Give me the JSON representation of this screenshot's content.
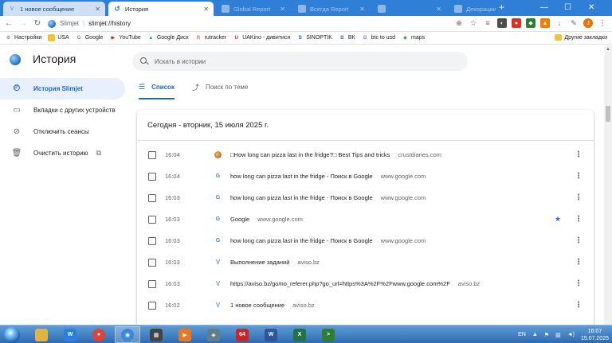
{
  "tabs": [
    {
      "title": "1 новое сообщение",
      "state": "inactive"
    },
    {
      "title": "История",
      "state": "active"
    },
    {
      "title": "Global Report",
      "state": "faded"
    },
    {
      "title": "Всегда Report",
      "state": "faded"
    },
    {
      "title": "",
      "state": "faded"
    },
    {
      "title": "Декорации – акция",
      "state": "faded"
    }
  ],
  "toolbar": {
    "site_label": "Slimjet",
    "url": "slimjet://history"
  },
  "bookmarks": [
    {
      "label": "Настройки",
      "color": "#5f6368",
      "glyph": "⚙"
    },
    {
      "label": "USA",
      "color": "#f4c430",
      "glyph": ""
    },
    {
      "label": "Google",
      "color": "#4285f4",
      "glyph": "G"
    },
    {
      "label": "YouTube",
      "color": "#ff0000",
      "glyph": "▶"
    },
    {
      "label": "Google Диск",
      "color": "#0f9d58",
      "glyph": "▲"
    },
    {
      "label": "rutracker",
      "color": "#e8702a",
      "glyph": "R"
    },
    {
      "label": "UAKino - дивитися",
      "color": "#c4161c",
      "glyph": "U"
    },
    {
      "label": "SINOPTIK",
      "color": "#1f5aa6",
      "glyph": "S"
    },
    {
      "label": "ВК",
      "color": "#4c75a3",
      "glyph": "В"
    },
    {
      "label": "btc to usd",
      "color": "#4285f4",
      "glyph": "G"
    },
    {
      "label": "maps",
      "color": "#34a853",
      "glyph": "◆"
    }
  ],
  "bookmarks_other": "Другие закладки",
  "page": {
    "title": "История",
    "search_placeholder": "Искать в истории"
  },
  "sidebar": [
    {
      "label": "История Slimjet",
      "icon": "history-icon",
      "selected": true
    },
    {
      "label": "Вкладки с других устройств",
      "icon": "devices-icon",
      "selected": false
    },
    {
      "label": "Отключить сеансы",
      "icon": "link-off-icon",
      "selected": false
    },
    {
      "label": "Очистить историю",
      "icon": "trash-icon",
      "selected": false
    }
  ],
  "history_tabs": [
    {
      "label": "Список",
      "selected": true
    },
    {
      "label": "Поиск по теме",
      "selected": false
    }
  ],
  "date_header": "Сегодня - вторник, 15 июля 2025 г.",
  "rows": [
    {
      "time": "16:04",
      "title": "□How long can pizza last in the fridge?□ Best Tips and tricks",
      "domain": "crustdiaries.com",
      "favicon": "crust",
      "starred": false
    },
    {
      "time": "16:04",
      "title": "how long can pizza last in the fridge - Поиск в Google",
      "domain": "www.google.com",
      "favicon": "google",
      "starred": false
    },
    {
      "time": "16:03",
      "title": "how long can pizza last in the fridge - Поиск в Google",
      "domain": "www.google.com",
      "favicon": "google",
      "starred": false
    },
    {
      "time": "16:03",
      "title": "Google",
      "domain": "www.google.com",
      "favicon": "google",
      "starred": true
    },
    {
      "time": "16:03",
      "title": "how long can pizza last in the fridge - Поиск в Google",
      "domain": "www.google.com",
      "favicon": "google",
      "starred": false
    },
    {
      "time": "16:03",
      "title": "Выполнение заданий",
      "domain": "aviso.bz",
      "favicon": "aviso",
      "starred": false
    },
    {
      "time": "16:03",
      "title": "https://aviso.bz/go/no_referer.php?go_url=https%3A%2F%2Fwww.google.com%2F",
      "domain": "aviso.bz",
      "favicon": "aviso",
      "starred": false
    },
    {
      "time": "16:02",
      "title": "1 новое сообщение",
      "domain": "aviso.bz",
      "favicon": "aviso",
      "starred": false
    }
  ],
  "taskbar": {
    "language": "EN",
    "time": "16:07",
    "date": "15.07.2025",
    "apps": [
      {
        "name": "explorer-icon",
        "color": "#e2b340",
        "glyph": ""
      },
      {
        "name": "wise-icon",
        "color": "#2a7de1",
        "glyph": "W"
      },
      {
        "name": "chrome-icon",
        "color": "#db4437",
        "glyph": "●"
      },
      {
        "name": "slimjet-icon",
        "color": "#3b8ad9",
        "glyph": "◉"
      },
      {
        "name": "screen-icon",
        "color": "#444444",
        "glyph": "▦"
      },
      {
        "name": "media-icon",
        "color": "#e87722",
        "glyph": "▶"
      },
      {
        "name": "shield-icon",
        "color": "#607d8b",
        "glyph": "◈"
      },
      {
        "name": "aida64-icon",
        "color": "#c62828",
        "glyph": "64"
      },
      {
        "name": "word-icon",
        "color": "#2b579a",
        "glyph": "W"
      },
      {
        "name": "excel-icon",
        "color": "#217346",
        "glyph": "X"
      },
      {
        "name": "cmd-icon",
        "color": "#2e7d32",
        "glyph": ">"
      }
    ]
  }
}
